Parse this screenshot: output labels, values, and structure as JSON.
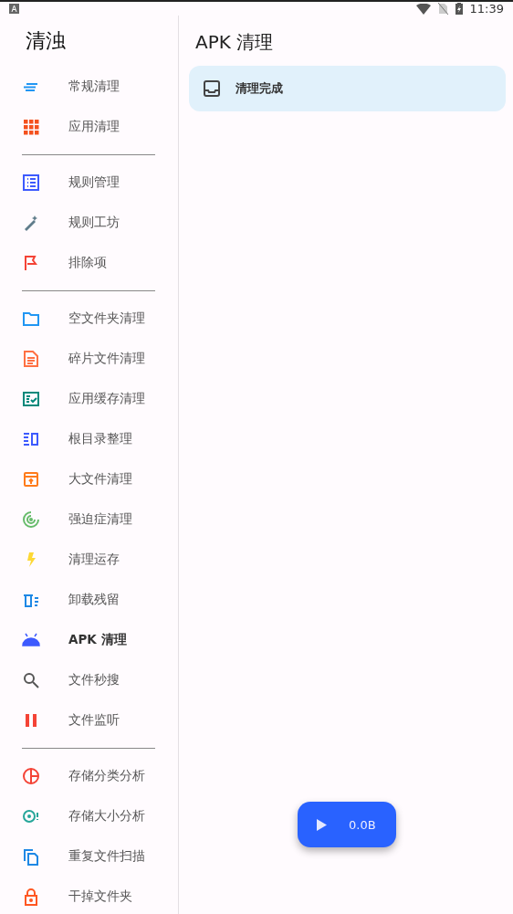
{
  "status_bar": {
    "time": "11:39"
  },
  "drawer": {
    "title": "清浊",
    "groups": [
      [
        {
          "label": "常规清理",
          "selected": false
        },
        {
          "label": "应用清理",
          "selected": false
        }
      ],
      [
        {
          "label": "规则管理",
          "selected": false
        },
        {
          "label": "规则工坊",
          "selected": false
        },
        {
          "label": "排除项",
          "selected": false
        }
      ],
      [
        {
          "label": "空文件夹清理",
          "selected": false
        },
        {
          "label": "碎片文件清理",
          "selected": false
        },
        {
          "label": "应用缓存清理",
          "selected": false
        },
        {
          "label": "根目录整理",
          "selected": false
        },
        {
          "label": "大文件清理",
          "selected": false
        },
        {
          "label": "强迫症清理",
          "selected": false
        },
        {
          "label": "清理运存",
          "selected": false
        },
        {
          "label": "卸载残留",
          "selected": false
        },
        {
          "label": "APK 清理",
          "selected": true
        },
        {
          "label": "文件秒搜",
          "selected": false
        },
        {
          "label": "文件监听",
          "selected": false
        }
      ],
      [
        {
          "label": "存储分类分析",
          "selected": false
        },
        {
          "label": "存储大小分析",
          "selected": false
        },
        {
          "label": "重复文件扫描",
          "selected": false
        },
        {
          "label": "干掉文件夹",
          "selected": false
        }
      ]
    ]
  },
  "main": {
    "title": "APK 清理",
    "status_card": {
      "text": "清理完成"
    },
    "fab": {
      "label": "0.0B"
    }
  }
}
